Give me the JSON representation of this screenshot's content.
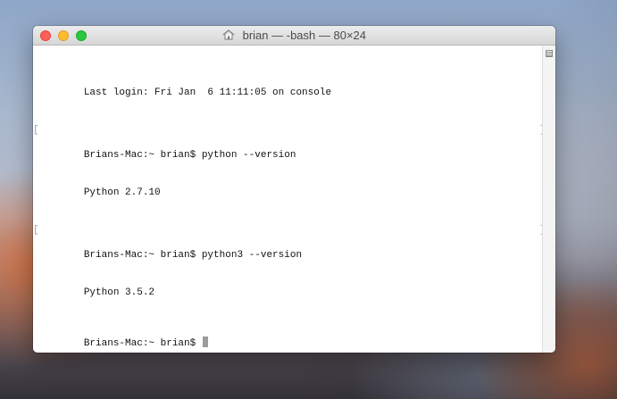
{
  "window": {
    "title": "brian — -bash — 80×24"
  },
  "terminal": {
    "lines": [
      "Last login: Fri Jan  6 11:11:05 on console",
      "Brians-Mac:~ brian$ python --version",
      "Python 2.7.10",
      "Brians-Mac:~ brian$ python3 --version",
      "Python 3.5.2",
      "Brians-Mac:~ brian$ "
    ],
    "markers": {
      "left": "[",
      "right": "]"
    }
  },
  "colors": {
    "close": "#ff5f57",
    "minimize": "#febc2e",
    "zoom": "#28c840",
    "text": "#111111",
    "cursor": "#9b9b9b"
  },
  "icons": {
    "title": "home-icon",
    "scroll": "resize-icon"
  }
}
